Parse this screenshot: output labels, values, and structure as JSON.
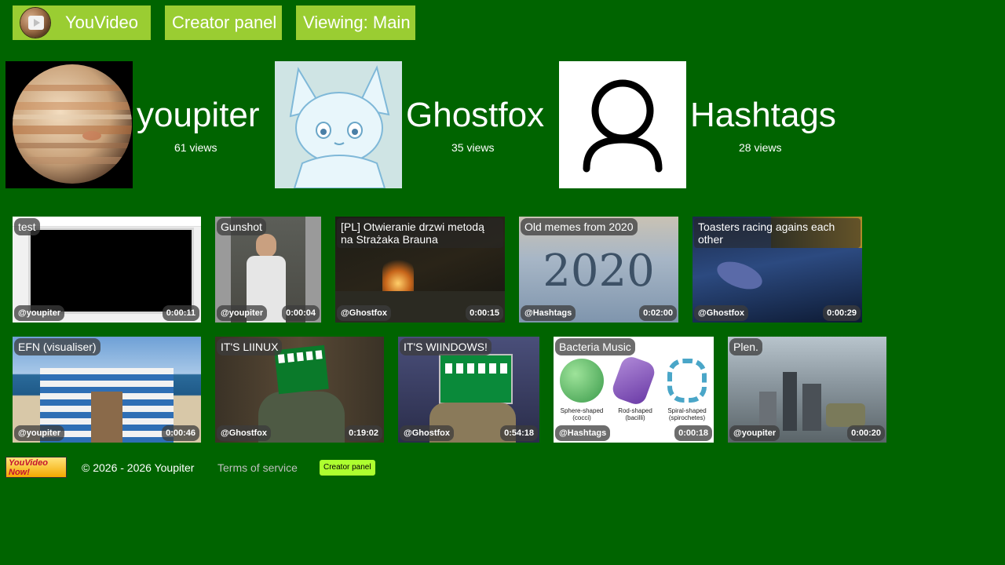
{
  "nav": {
    "home_label": "YouVideo",
    "creator_label": "Creator panel",
    "viewing_label": "Viewing: Main"
  },
  "channels": [
    {
      "name": "youpiter",
      "views": "61 views"
    },
    {
      "name": "Ghostfox",
      "views": "35 views"
    },
    {
      "name": "Hashtags",
      "views": "28 views"
    }
  ],
  "videos": [
    {
      "title": "test",
      "author": "@youpiter",
      "duration": "0:00:11"
    },
    {
      "title": "Gunshot",
      "author": "@youpiter",
      "duration": "0:00:04"
    },
    {
      "title": "[PL] Otwieranie drzwi metodą na Strażaka Brauna",
      "author": "@Ghostfox",
      "duration": "0:00:15"
    },
    {
      "title": "Old memes from 2020",
      "author": "@Hashtags",
      "duration": "0:02:00"
    },
    {
      "title": "Toasters racing agains each other",
      "author": "@Ghostfox",
      "duration": "0:00:29"
    },
    {
      "title": "EFN (visualiser)",
      "author": "@youpiter",
      "duration": "0:00:46"
    },
    {
      "title": "IT'S LIINUX",
      "author": "@Ghostfox",
      "duration": "0:19:02"
    },
    {
      "title": "IT'S WIINDOWS!",
      "author": "@Ghostfox",
      "duration": "0:54:18"
    },
    {
      "title": "Bacteria Music",
      "author": "@Hashtags",
      "duration": "0:00:18"
    },
    {
      "title": "Plen.",
      "author": "@youpiter",
      "duration": "0:00:20"
    }
  ],
  "thumb_text": {
    "year": "2020",
    "bacteria_labels": [
      "Sphere-shaped\n(cocci)",
      "Rod-shaped\n(bacilli)",
      "Spiral-shaped\n(spirochetes)"
    ]
  },
  "footer": {
    "badge_text": "YouVideo Now!",
    "copyright": "© 2026 - 2026 Youpiter",
    "terms_label": "Terms of service",
    "creator_label": "Creator panel"
  },
  "colors": {
    "background": "#006400",
    "nav_button": "#9acd32",
    "creator_small": "#adff2f"
  },
  "icons": {
    "logo": "play-logo-icon",
    "default_avatar": "user-icon"
  }
}
